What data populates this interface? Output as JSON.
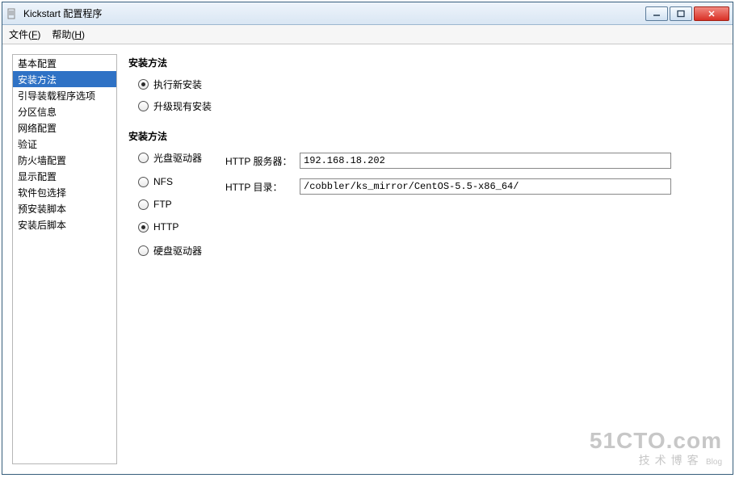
{
  "window": {
    "title": "Kickstart 配置程序"
  },
  "menu": {
    "file": "文件(F)",
    "help": "帮助(H)"
  },
  "sidebar": {
    "items": [
      "基本配置",
      "安装方法",
      "引导装载程序选项",
      "分区信息",
      "网络配置",
      "验证",
      "防火墙配置",
      "显示配置",
      "软件包选择",
      "预安装脚本",
      "安装后脚本"
    ],
    "selected_index": 1
  },
  "section1": {
    "title": "安装方法",
    "opt_new": "执行新安装",
    "opt_upgrade": "升级现有安装",
    "selected": "new"
  },
  "section2": {
    "title": "安装方法",
    "opt_cdrom": "光盘驱动器",
    "opt_nfs": "NFS",
    "opt_ftp": "FTP",
    "opt_http": "HTTP",
    "opt_hd": "硬盘驱动器",
    "selected": "http",
    "http_server_label": "HTTP 服务器：",
    "http_server_value": "192.168.18.202",
    "http_dir_label": "HTTP 目录：",
    "http_dir_value": "/cobbler/ks_mirror/CentOS-5.5-x86_64/"
  },
  "watermark": {
    "big": "51CTO.com",
    "small": "技术博客",
    "tag": "Blog"
  }
}
